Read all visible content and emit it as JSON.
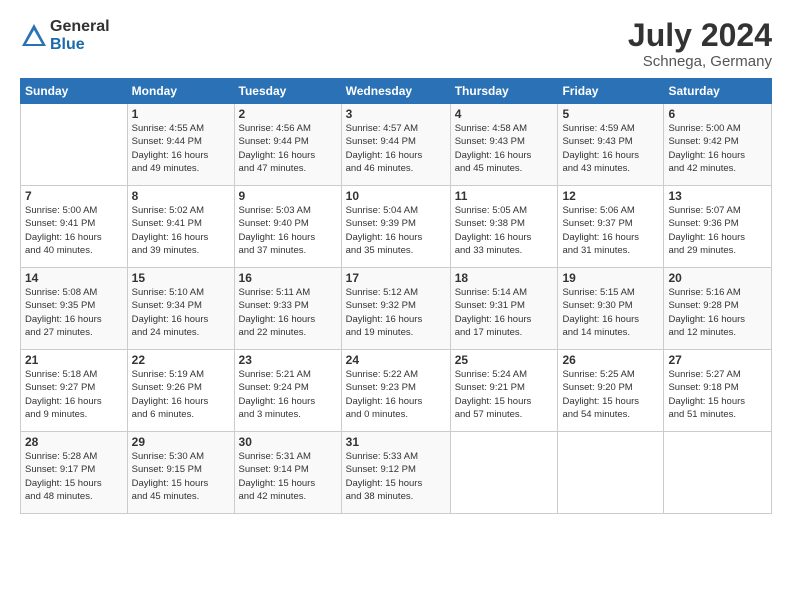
{
  "logo": {
    "general": "General",
    "blue": "Blue"
  },
  "title": "July 2024",
  "subtitle": "Schnega, Germany",
  "header_days": [
    "Sunday",
    "Monday",
    "Tuesday",
    "Wednesday",
    "Thursday",
    "Friday",
    "Saturday"
  ],
  "weeks": [
    [
      {
        "day": "",
        "info": ""
      },
      {
        "day": "1",
        "info": "Sunrise: 4:55 AM\nSunset: 9:44 PM\nDaylight: 16 hours\nand 49 minutes."
      },
      {
        "day": "2",
        "info": "Sunrise: 4:56 AM\nSunset: 9:44 PM\nDaylight: 16 hours\nand 47 minutes."
      },
      {
        "day": "3",
        "info": "Sunrise: 4:57 AM\nSunset: 9:44 PM\nDaylight: 16 hours\nand 46 minutes."
      },
      {
        "day": "4",
        "info": "Sunrise: 4:58 AM\nSunset: 9:43 PM\nDaylight: 16 hours\nand 45 minutes."
      },
      {
        "day": "5",
        "info": "Sunrise: 4:59 AM\nSunset: 9:43 PM\nDaylight: 16 hours\nand 43 minutes."
      },
      {
        "day": "6",
        "info": "Sunrise: 5:00 AM\nSunset: 9:42 PM\nDaylight: 16 hours\nand 42 minutes."
      }
    ],
    [
      {
        "day": "7",
        "info": "Sunrise: 5:00 AM\nSunset: 9:41 PM\nDaylight: 16 hours\nand 40 minutes."
      },
      {
        "day": "8",
        "info": "Sunrise: 5:02 AM\nSunset: 9:41 PM\nDaylight: 16 hours\nand 39 minutes."
      },
      {
        "day": "9",
        "info": "Sunrise: 5:03 AM\nSunset: 9:40 PM\nDaylight: 16 hours\nand 37 minutes."
      },
      {
        "day": "10",
        "info": "Sunrise: 5:04 AM\nSunset: 9:39 PM\nDaylight: 16 hours\nand 35 minutes."
      },
      {
        "day": "11",
        "info": "Sunrise: 5:05 AM\nSunset: 9:38 PM\nDaylight: 16 hours\nand 33 minutes."
      },
      {
        "day": "12",
        "info": "Sunrise: 5:06 AM\nSunset: 9:37 PM\nDaylight: 16 hours\nand 31 minutes."
      },
      {
        "day": "13",
        "info": "Sunrise: 5:07 AM\nSunset: 9:36 PM\nDaylight: 16 hours\nand 29 minutes."
      }
    ],
    [
      {
        "day": "14",
        "info": "Sunrise: 5:08 AM\nSunset: 9:35 PM\nDaylight: 16 hours\nand 27 minutes."
      },
      {
        "day": "15",
        "info": "Sunrise: 5:10 AM\nSunset: 9:34 PM\nDaylight: 16 hours\nand 24 minutes."
      },
      {
        "day": "16",
        "info": "Sunrise: 5:11 AM\nSunset: 9:33 PM\nDaylight: 16 hours\nand 22 minutes."
      },
      {
        "day": "17",
        "info": "Sunrise: 5:12 AM\nSunset: 9:32 PM\nDaylight: 16 hours\nand 19 minutes."
      },
      {
        "day": "18",
        "info": "Sunrise: 5:14 AM\nSunset: 9:31 PM\nDaylight: 16 hours\nand 17 minutes."
      },
      {
        "day": "19",
        "info": "Sunrise: 5:15 AM\nSunset: 9:30 PM\nDaylight: 16 hours\nand 14 minutes."
      },
      {
        "day": "20",
        "info": "Sunrise: 5:16 AM\nSunset: 9:28 PM\nDaylight: 16 hours\nand 12 minutes."
      }
    ],
    [
      {
        "day": "21",
        "info": "Sunrise: 5:18 AM\nSunset: 9:27 PM\nDaylight: 16 hours\nand 9 minutes."
      },
      {
        "day": "22",
        "info": "Sunrise: 5:19 AM\nSunset: 9:26 PM\nDaylight: 16 hours\nand 6 minutes."
      },
      {
        "day": "23",
        "info": "Sunrise: 5:21 AM\nSunset: 9:24 PM\nDaylight: 16 hours\nand 3 minutes."
      },
      {
        "day": "24",
        "info": "Sunrise: 5:22 AM\nSunset: 9:23 PM\nDaylight: 16 hours\nand 0 minutes."
      },
      {
        "day": "25",
        "info": "Sunrise: 5:24 AM\nSunset: 9:21 PM\nDaylight: 15 hours\nand 57 minutes."
      },
      {
        "day": "26",
        "info": "Sunrise: 5:25 AM\nSunset: 9:20 PM\nDaylight: 15 hours\nand 54 minutes."
      },
      {
        "day": "27",
        "info": "Sunrise: 5:27 AM\nSunset: 9:18 PM\nDaylight: 15 hours\nand 51 minutes."
      }
    ],
    [
      {
        "day": "28",
        "info": "Sunrise: 5:28 AM\nSunset: 9:17 PM\nDaylight: 15 hours\nand 48 minutes."
      },
      {
        "day": "29",
        "info": "Sunrise: 5:30 AM\nSunset: 9:15 PM\nDaylight: 15 hours\nand 45 minutes."
      },
      {
        "day": "30",
        "info": "Sunrise: 5:31 AM\nSunset: 9:14 PM\nDaylight: 15 hours\nand 42 minutes."
      },
      {
        "day": "31",
        "info": "Sunrise: 5:33 AM\nSunset: 9:12 PM\nDaylight: 15 hours\nand 38 minutes."
      },
      {
        "day": "",
        "info": ""
      },
      {
        "day": "",
        "info": ""
      },
      {
        "day": "",
        "info": ""
      }
    ]
  ]
}
